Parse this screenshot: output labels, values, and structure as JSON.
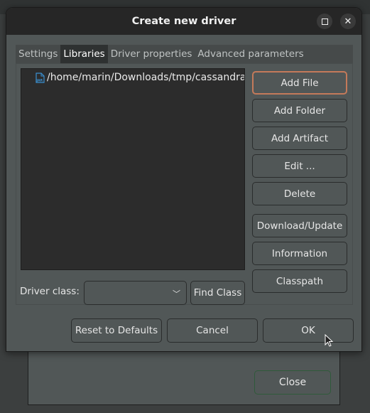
{
  "parent_window": {
    "close_label": "Close"
  },
  "dialog": {
    "title": "Create new driver",
    "maximize_icon": "maximize-icon",
    "close_icon": "close-icon"
  },
  "tabs": [
    {
      "label": "Settings",
      "active": false
    },
    {
      "label": "Libraries",
      "active": true
    },
    {
      "label": "Driver properties",
      "active": false
    },
    {
      "label": "Advanced parameters",
      "active": false
    }
  ],
  "libraries": {
    "files": [
      {
        "icon": "jar-file-icon",
        "path": "/home/marin/Downloads/tmp/cassandra"
      }
    ],
    "buttons": {
      "add_file": "Add File",
      "add_folder": "Add Folder",
      "add_artifact": "Add Artifact",
      "edit": "Edit ...",
      "delete": "Delete",
      "download_update": "Download/Update",
      "information": "Information",
      "classpath": "Classpath"
    },
    "driver_class_label": "Driver class:",
    "driver_class_value": "",
    "find_class_label": "Find Class"
  },
  "footer": {
    "reset_label": "Reset to Defaults",
    "cancel_label": "Cancel",
    "ok_label": "OK"
  },
  "colors": {
    "focus_border": "#c47a5a",
    "jar_icon": "#3a8fd0",
    "close_border": "#2f5a3a"
  }
}
